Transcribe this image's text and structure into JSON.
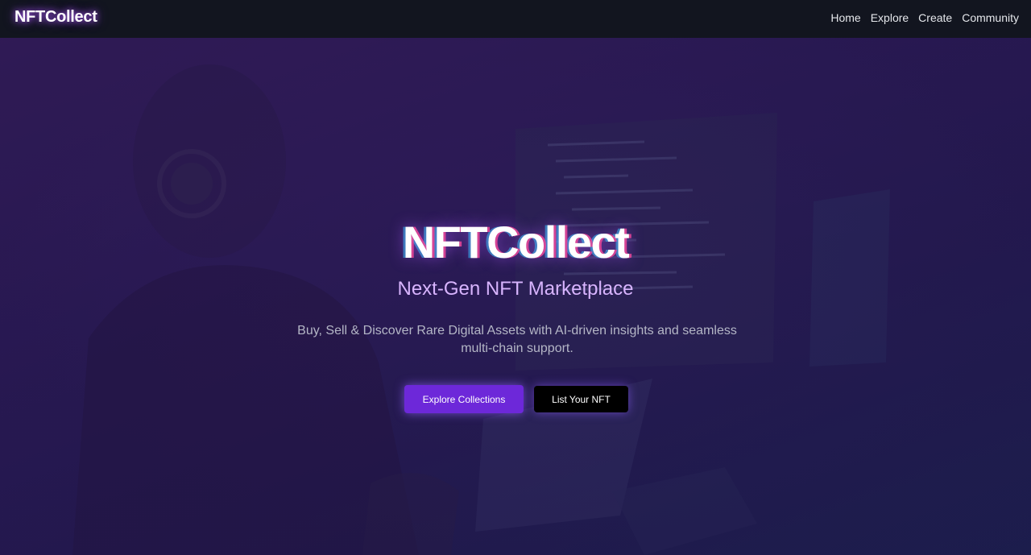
{
  "navbar": {
    "brand": "NFTCollect",
    "links": [
      {
        "label": "Home"
      },
      {
        "label": "Explore"
      },
      {
        "label": "Create"
      },
      {
        "label": "Community"
      }
    ]
  },
  "hero": {
    "title": "NFTCollect",
    "subtitle": "Next-Gen NFT Marketplace",
    "description": "Buy, Sell & Discover Rare Digital Assets with AI-driven insights and seamless multi-chain support.",
    "primary_button": "Explore Collections",
    "secondary_button": "List Your NFT"
  },
  "colors": {
    "accent": "#6d28d9",
    "navbar_bg": "#12151f",
    "subtitle": "#d8b4fe",
    "glow": "#a855f7"
  }
}
